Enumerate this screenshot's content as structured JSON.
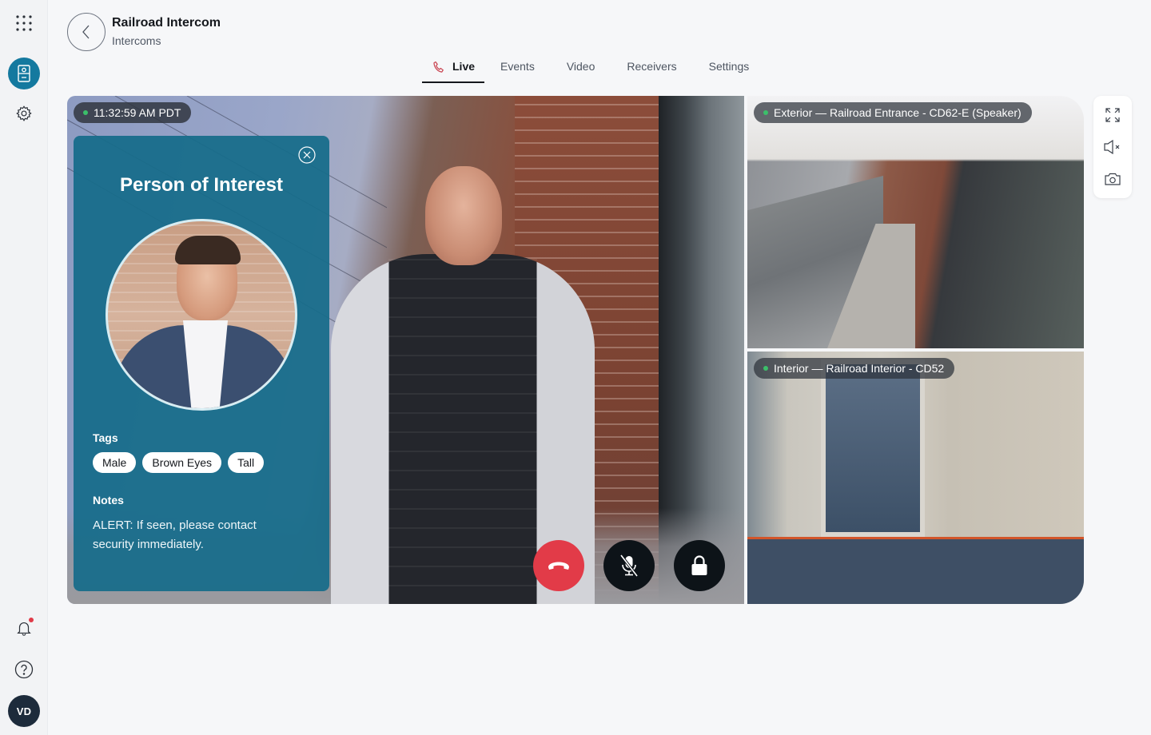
{
  "header": {
    "title": "Railroad Intercom",
    "subtitle": "Intercoms"
  },
  "sidebar": {
    "top_items": [
      {
        "name": "apps",
        "icon": "grid-icon"
      },
      {
        "name": "intercoms",
        "icon": "intercom-icon",
        "active": true
      },
      {
        "name": "settings",
        "icon": "gear-icon"
      }
    ],
    "bottom_items": [
      {
        "name": "notifications",
        "icon": "bell-icon",
        "has_badge": true
      },
      {
        "name": "help",
        "icon": "help-icon"
      }
    ],
    "avatar_initials": "VD"
  },
  "tabs": [
    {
      "label": "Live",
      "icon": "phone-icon",
      "active": true
    },
    {
      "label": "Events"
    },
    {
      "label": "Video"
    },
    {
      "label": "Receivers"
    },
    {
      "label": "Settings"
    }
  ],
  "main_feed": {
    "timestamp": "11:32:59 AM PDT",
    "status": "live"
  },
  "poi_panel": {
    "title": "Person of Interest",
    "tags_label": "Tags",
    "tags": [
      "Male",
      "Brown Eyes",
      "Tall"
    ],
    "notes_label": "Notes",
    "notes": "ALERT: If seen, please contact security immediately."
  },
  "call_controls": [
    {
      "name": "hang-up",
      "icon": "phone-hangup-icon",
      "color": "#e23b48"
    },
    {
      "name": "mute",
      "icon": "mic-off-icon",
      "color": "#0d1318"
    },
    {
      "name": "unlock",
      "icon": "lock-icon",
      "color": "#0d1318"
    }
  ],
  "side_feeds": [
    {
      "label": "Exterior — Railroad Entrance - CD62-E (Speaker)",
      "status": "live"
    },
    {
      "label": "Interior — Railroad Interior - CD52",
      "status": "live"
    }
  ],
  "toolbar": [
    {
      "name": "fullscreen",
      "icon": "expand-icon"
    },
    {
      "name": "speaker-muted",
      "icon": "speaker-mute-icon"
    },
    {
      "name": "snapshot",
      "icon": "camera-icon"
    }
  ],
  "colors": {
    "accent": "#14799f",
    "panel": "#156c8a",
    "live": "#3bbf6a",
    "danger": "#e23b48",
    "badge": "#e03a48"
  }
}
